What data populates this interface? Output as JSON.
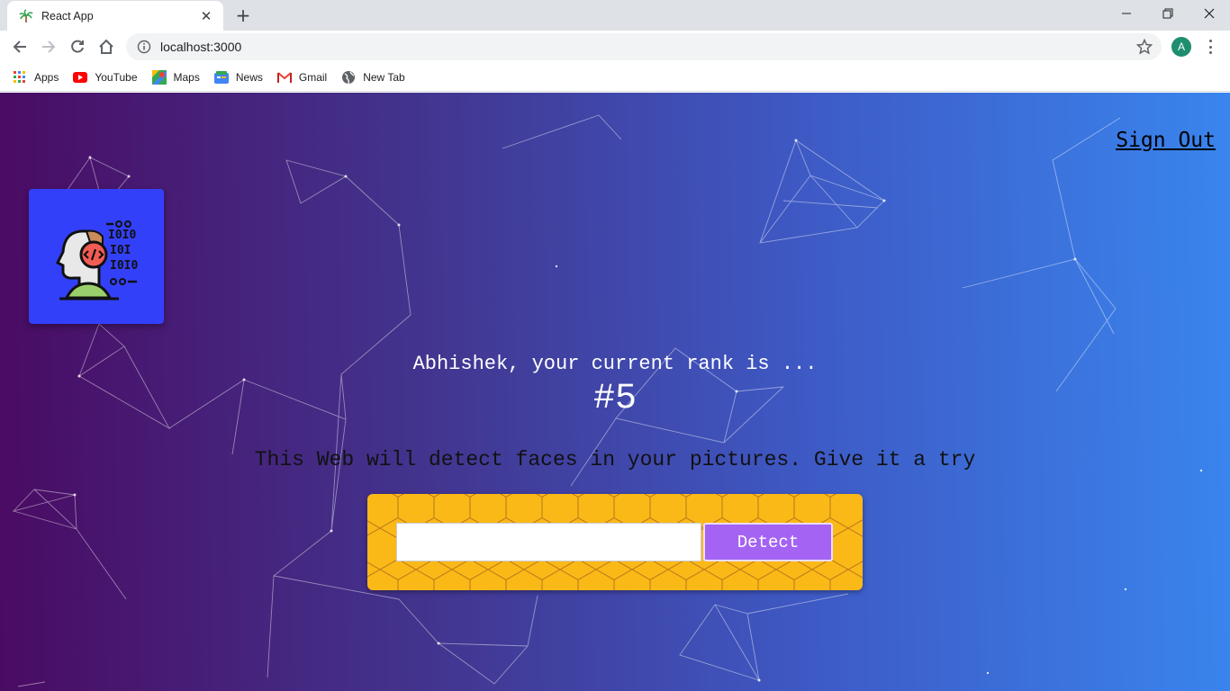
{
  "browser": {
    "tab_title": "React App",
    "url": "localhost:3000",
    "profile_initial": "A",
    "bookmarks": [
      {
        "label": "Apps",
        "icon": "apps-grid-icon"
      },
      {
        "label": "YouTube",
        "icon": "youtube-icon"
      },
      {
        "label": "Maps",
        "icon": "maps-icon"
      },
      {
        "label": "News",
        "icon": "news-icon"
      },
      {
        "label": "Gmail",
        "icon": "gmail-icon"
      },
      {
        "label": "New Tab",
        "icon": "globe-icon"
      }
    ]
  },
  "nav": {
    "sign_out": "Sign Out"
  },
  "rank": {
    "message": "Abhishek, your current rank is ...",
    "value": "#5"
  },
  "tagline": "This Web will detect faces in your pictures. Give it a try",
  "form": {
    "input_value": "",
    "button_label": "Detect"
  },
  "colors": {
    "gradient_start": "#4a0b63",
    "gradient_end": "#3a85ee",
    "logo_bg": "#3340fa",
    "button_bg": "#a463f2",
    "honeycomb": "#fbb917"
  }
}
